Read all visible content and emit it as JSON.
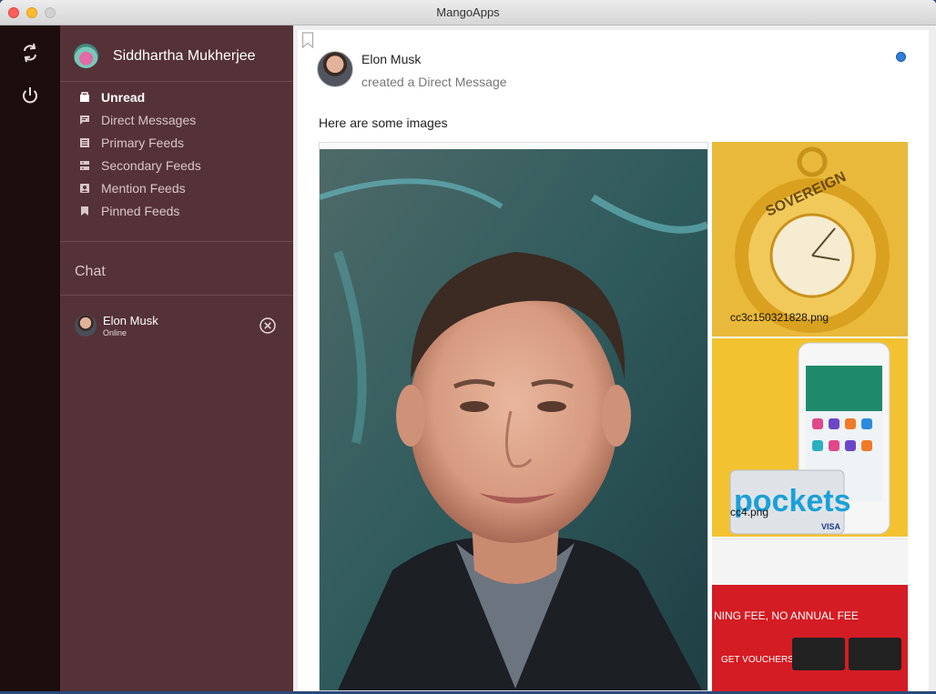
{
  "window": {
    "title": "MangoApps"
  },
  "profile": {
    "name": "Siddhartha Mukherjee"
  },
  "nav": {
    "items": [
      {
        "label": "Unread",
        "icon": "inbox-icon",
        "active": true
      },
      {
        "label": "Direct Messages",
        "icon": "message-icon",
        "active": false
      },
      {
        "label": "Primary Feeds",
        "icon": "list-icon",
        "active": false
      },
      {
        "label": "Secondary Feeds",
        "icon": "stack-icon",
        "active": false
      },
      {
        "label": "Mention Feeds",
        "icon": "contact-icon",
        "active": false
      },
      {
        "label": "Pinned Feeds",
        "icon": "bookmark-icon",
        "active": false
      }
    ]
  },
  "chat": {
    "header": "Chat",
    "contacts": [
      {
        "name": "Elon Musk",
        "status": "Online"
      }
    ]
  },
  "post": {
    "author": "Elon Musk",
    "action": "created a Direct Message",
    "message": "Here are some images",
    "attachments": [
      {
        "label": ""
      },
      {
        "label": "cc3c150321828.png"
      },
      {
        "label": "cc4.png"
      },
      {
        "label": ""
      }
    ]
  },
  "colors": {
    "rail": "#1e0d0d",
    "sidebar": "#553238",
    "unread_dot": "#2f7ed8"
  }
}
